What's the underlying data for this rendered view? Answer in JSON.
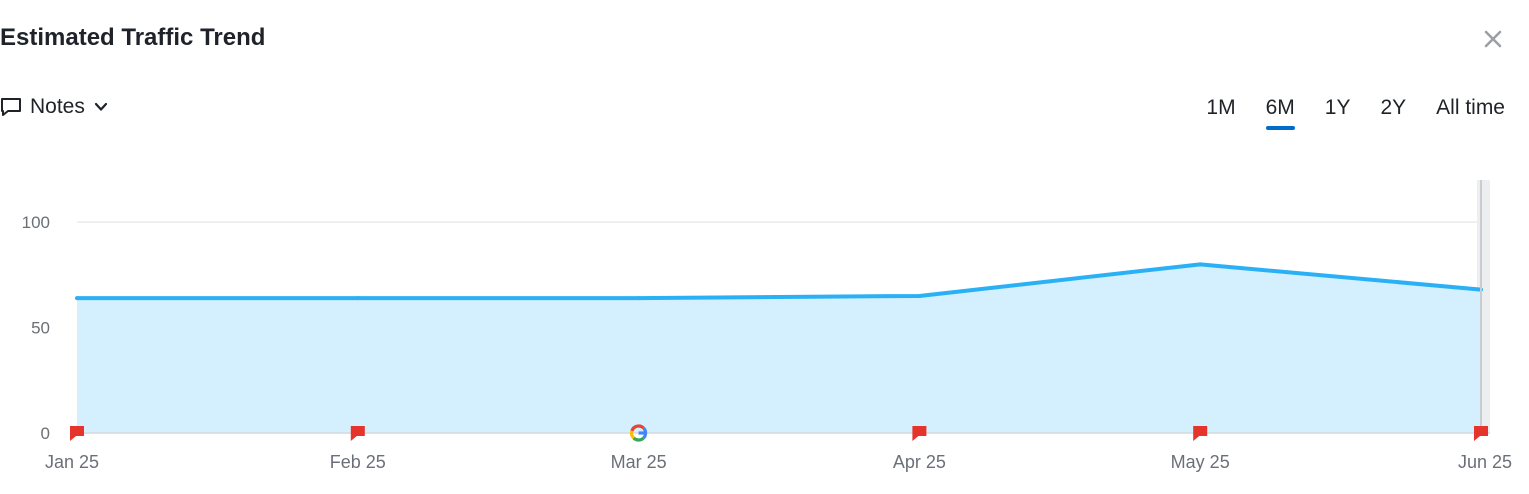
{
  "header": {
    "title": "Estimated Traffic Trend"
  },
  "notes": {
    "label": "Notes"
  },
  "ranges": [
    {
      "label": "1M",
      "active": false
    },
    {
      "label": "6M",
      "active": true
    },
    {
      "label": "1Y",
      "active": false
    },
    {
      "label": "2Y",
      "active": false
    },
    {
      "label": "All time",
      "active": false
    }
  ],
  "colors": {
    "line": "#2ab0f5",
    "area": "#d4effd",
    "flag": "#e5342b",
    "grid": "#e9ebee",
    "cursor": "#c9cdd2"
  },
  "chart_data": {
    "type": "area",
    "x": [
      "Jan 25",
      "Feb 25",
      "Mar 25",
      "Apr 25",
      "May 25",
      "Jun 25"
    ],
    "series": [
      {
        "values": [
          64,
          64,
          64,
          65,
          80,
          68
        ]
      }
    ],
    "yticks": [
      0,
      50,
      100
    ],
    "ylim": [
      0,
      120
    ],
    "grid": true,
    "markers": [
      {
        "x": "Jan 25",
        "icon": "flag-icon"
      },
      {
        "x": "Feb 25",
        "icon": "flag-icon"
      },
      {
        "x": "Mar 25",
        "icon": "google-icon"
      },
      {
        "x": "Apr 25",
        "icon": "flag-icon"
      },
      {
        "x": "May 25",
        "icon": "flag-icon"
      },
      {
        "x": "Jun 25",
        "icon": "flag-icon"
      }
    ]
  }
}
